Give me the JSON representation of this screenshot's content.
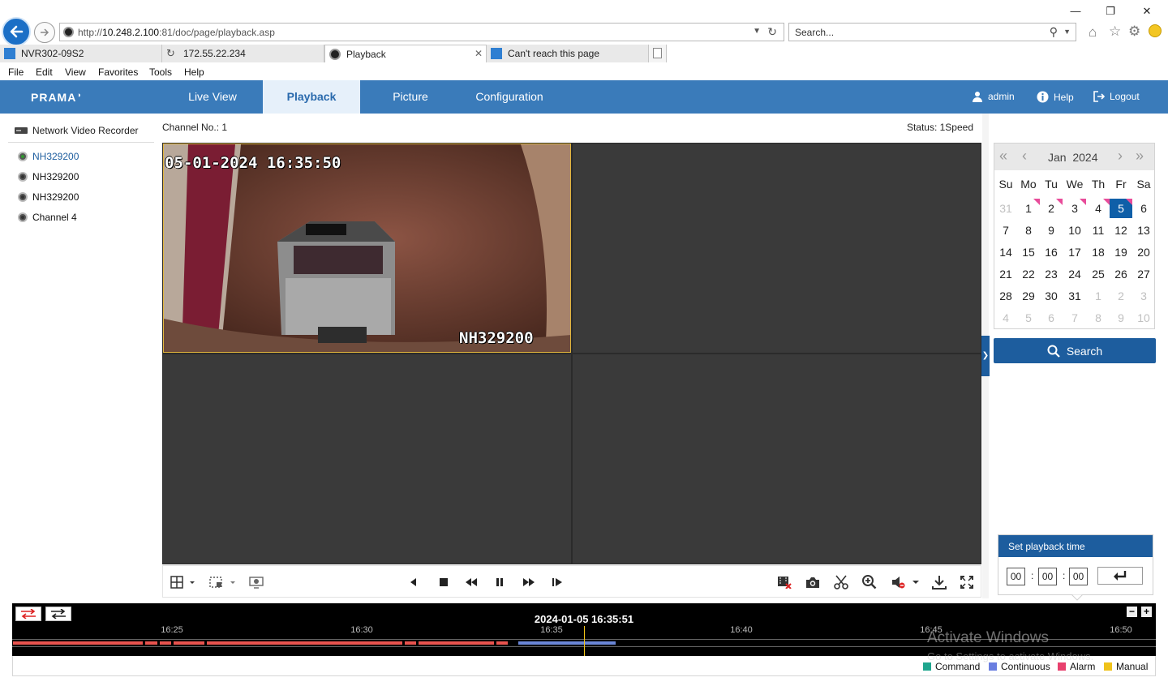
{
  "browser": {
    "url_prefix": "http://",
    "url_host": "10.248.2.100",
    "url_rest": ":81/doc/page/playback.asp",
    "search_placeholder": "Search...",
    "tabs": [
      {
        "label": "NVR302-09S2"
      },
      {
        "label": "172.55.22.234"
      },
      {
        "label": "Playback"
      },
      {
        "label": "Can't reach this page"
      }
    ],
    "menu": [
      "File",
      "Edit",
      "View",
      "Favorites",
      "Tools",
      "Help"
    ]
  },
  "app": {
    "logo": "PRAMA",
    "nav": [
      "Live View",
      "Playback",
      "Picture",
      "Configuration"
    ],
    "active_nav": "Playback",
    "user": "admin",
    "help": "Help",
    "logout": "Logout"
  },
  "tree": {
    "root": "Network Video Recorder",
    "channels": [
      "NH329200",
      "NH329200",
      "NH329200",
      "Channel 4"
    ]
  },
  "player": {
    "channel_no": "Channel No.: 1",
    "status": "Status: 1Speed",
    "osd_time": "05-01-2024 16:35:50",
    "osd_name": "NH329200"
  },
  "calendar": {
    "month": "Jan",
    "year": "2024",
    "weekdays": [
      "Su",
      "Mo",
      "Tu",
      "We",
      "Th",
      "Fr",
      "Sa"
    ],
    "weeks": [
      [
        "31",
        "1",
        "2",
        "3",
        "4",
        "5",
        "6"
      ],
      [
        "7",
        "8",
        "9",
        "10",
        "11",
        "12",
        "13"
      ],
      [
        "14",
        "15",
        "16",
        "17",
        "18",
        "19",
        "20"
      ],
      [
        "21",
        "22",
        "23",
        "24",
        "25",
        "26",
        "27"
      ],
      [
        "28",
        "29",
        "30",
        "31",
        "1",
        "2",
        "3"
      ],
      [
        "4",
        "5",
        "6",
        "7",
        "8",
        "9",
        "10"
      ]
    ],
    "selected_day": "5",
    "recorded_days": [
      "1",
      "2",
      "3",
      "4",
      "5"
    ],
    "search_label": "Search"
  },
  "playback_time": {
    "title": "Set playback time",
    "hh": "00",
    "mm": "00",
    "ss": "00",
    "sep": ":"
  },
  "timeline": {
    "current": "2024-01-05 16:35:51",
    "ticks": [
      "16:25",
      "16:30",
      "16:35",
      "16:40",
      "16:45",
      "16:50"
    ],
    "legend": [
      {
        "label": "Command",
        "color": "#1fa68e"
      },
      {
        "label": "Continuous",
        "color": "#6a7ee0"
      },
      {
        "label": "Alarm",
        "color": "#e8416e"
      },
      {
        "label": "Manual",
        "color": "#efc21a"
      }
    ],
    "alarm_color": "#e8534e",
    "continuous_color": "#6a86d6"
  },
  "watermark": {
    "line1": "Activate Windows",
    "line2": "Go to Settings to activate Windows."
  }
}
